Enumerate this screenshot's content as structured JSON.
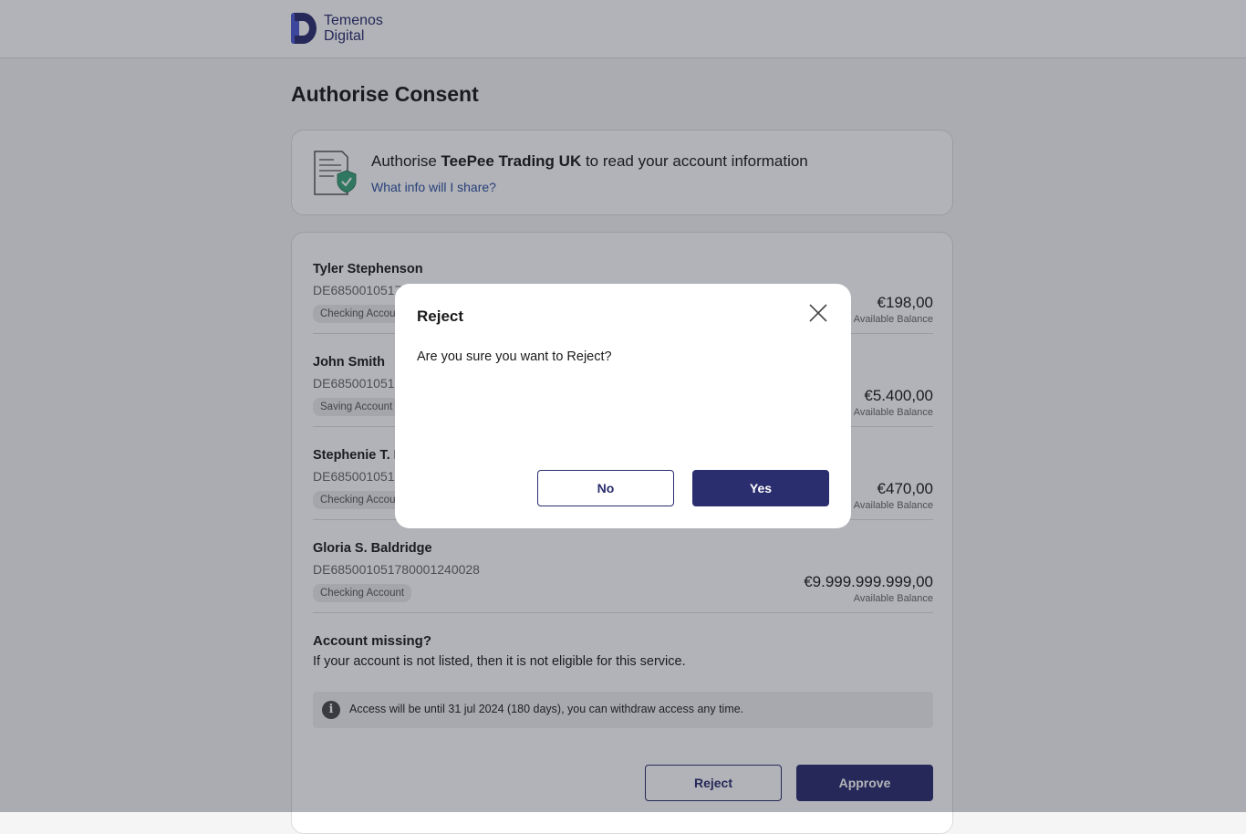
{
  "header": {
    "logo_line1": "Temenos",
    "logo_line2": "Digital",
    "logo_icon": "temenos-logo-icon"
  },
  "page_title": "Authorise Consent",
  "consent": {
    "icon": "document-shield-icon",
    "prefix": "Authorise ",
    "tpp_name": "TeePee Trading UK",
    "suffix": " to read your account information",
    "link": "What info will I share?"
  },
  "accounts": [
    {
      "name": "Tyler Stephenson",
      "iban": "DE68500105178000124002​8",
      "type": "Checking Account",
      "balance": "€198,00",
      "balance_label": "Available Balance"
    },
    {
      "name": "John Smith",
      "iban": "DE68500105178000124002​8",
      "type": "Saving Account",
      "balance": "€5.400,00",
      "balance_label": "Available Balance"
    },
    {
      "name": "Stephenie T. D",
      "iban": "DE68500105178000124002​8",
      "type": "Checking Account",
      "balance": "€470,00",
      "balance_label": "Available Balance"
    },
    {
      "name": "Gloria S. Baldridge",
      "iban": "DE685001051780001240028",
      "type": "Checking Account",
      "balance": "€9.999.999.999,00",
      "balance_label": "Available Balance"
    }
  ],
  "missing": {
    "title": "Account missing?",
    "text": "If your account is not listed, then it is not eligible for this service."
  },
  "info": {
    "icon": "info-icon",
    "glyph": "i",
    "text": "Access will be until 31 jul 2024 (180 days), you can withdraw access any time."
  },
  "actions": {
    "reject": "Reject",
    "approve": "Approve"
  },
  "modal": {
    "title": "Reject",
    "message": "Are you sure you want to Reject?",
    "no": "No",
    "yes": "Yes",
    "close_icon": "close-icon"
  },
  "colors": {
    "brand": "#2a2d6e",
    "link": "#2b4fa0",
    "shield": "#3aa57a"
  }
}
